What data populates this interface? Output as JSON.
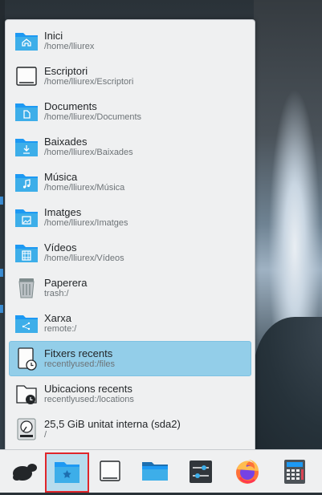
{
  "places": [
    {
      "name": "Inici",
      "path": "/home/lliurex",
      "icon": "folder-home-icon"
    },
    {
      "name": "Escriptori",
      "path": "/home/lliurex/Escriptori",
      "icon": "desktop-icon"
    },
    {
      "name": "Documents",
      "path": "/home/lliurex/Documents",
      "icon": "folder-documents-icon"
    },
    {
      "name": "Baixades",
      "path": "/home/lliurex/Baixades",
      "icon": "folder-downloads-icon"
    },
    {
      "name": "Música",
      "path": "/home/lliurex/Música",
      "icon": "folder-music-icon"
    },
    {
      "name": "Imatges",
      "path": "/home/lliurex/Imatges",
      "icon": "folder-pictures-icon"
    },
    {
      "name": "Vídeos",
      "path": "/home/lliurex/Vídeos",
      "icon": "folder-videos-icon"
    },
    {
      "name": "Paperera",
      "path": "trash:/",
      "icon": "trash-icon"
    },
    {
      "name": "Xarxa",
      "path": "remote:/",
      "icon": "folder-network-icon"
    },
    {
      "name": "Fitxers recents",
      "path": "recentlyused:/files",
      "icon": "recent-files-icon",
      "selected": true
    },
    {
      "name": "Ubicacions recents",
      "path": "recentlyused:/locations",
      "icon": "recent-locations-icon"
    },
    {
      "name": "25,5 GiB unitat interna (sda2)",
      "path": "/",
      "icon": "hard-drive-icon"
    }
  ],
  "taskbar": [
    {
      "name": "application-launcher-icon",
      "active": false
    },
    {
      "name": "folder-view-widget-icon",
      "active": true
    },
    {
      "name": "show-desktop-icon",
      "active": false
    },
    {
      "name": "dolphin-file-manager-icon",
      "active": false
    },
    {
      "name": "system-settings-icon",
      "active": false
    },
    {
      "name": "firefox-icon",
      "active": false
    },
    {
      "name": "calculator-icon",
      "active": false
    }
  ],
  "colors": {
    "folder": "#3daee9",
    "selection": "#93cee9",
    "active_outline": "#e0262b"
  }
}
